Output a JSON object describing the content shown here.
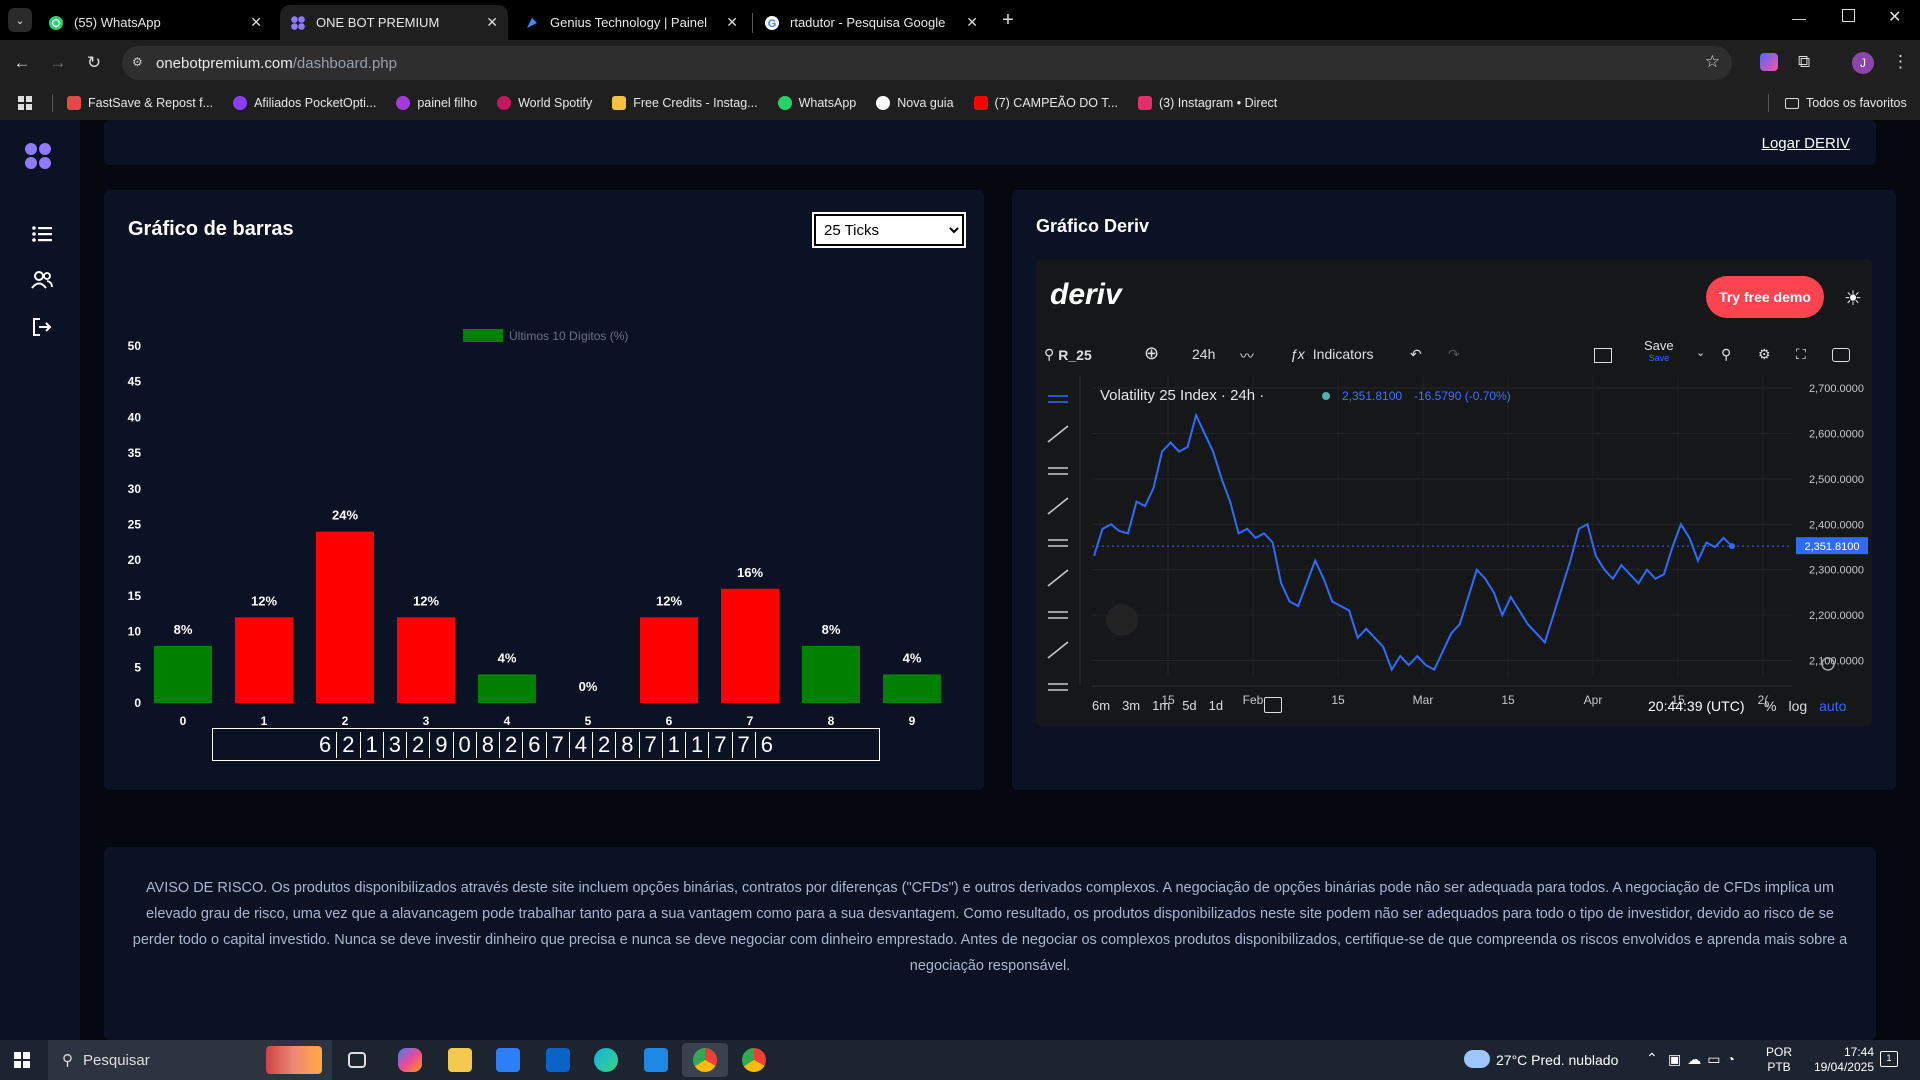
{
  "browser": {
    "tabs": [
      {
        "title": "(55) WhatsApp",
        "icon": "whatsapp-icon",
        "color": "#25d366"
      },
      {
        "title": "ONE BOT PREMIUM",
        "icon": "onebot-icon",
        "color": "#8f7bff"
      },
      {
        "title": "Genius Technology | Painel",
        "icon": "genius-icon",
        "color": "#3a8dff"
      },
      {
        "title": "rtadutor - Pesquisa Google",
        "icon": "google-icon",
        "color": "#ffffff"
      }
    ],
    "url_host": "onebotpremium.com",
    "url_path": "/dashboard.php",
    "profile_initial": "J",
    "bookmarks": [
      {
        "label": "FastSave & Repost f...",
        "color": "#e34b4b"
      },
      {
        "label": "Afiliados PocketOpti...",
        "color": "#8b3dff"
      },
      {
        "label": "painel filho",
        "color": "#a33bd6"
      },
      {
        "label": "World Spotify",
        "color": "#c2185b"
      },
      {
        "label": "Free Credits - Instag...",
        "color": "#f5c242"
      },
      {
        "label": "WhatsApp",
        "color": "#25d366"
      },
      {
        "label": "Nova guia",
        "color": "#ffffff"
      },
      {
        "label": "(7) CAMPEÃO DO T...",
        "color": "#ff0000"
      },
      {
        "label": "(3) Instagram • Direct",
        "color": "#e1306c"
      }
    ],
    "all_bookmarks": "Todos os favoritos"
  },
  "header": {
    "login_link": "Logar DERIV"
  },
  "bar_chart_panel": {
    "title": "Gráfico de barras",
    "select_value": "25 Ticks",
    "select_options": [
      "25 Ticks"
    ],
    "digits": [
      "6",
      "2",
      "1",
      "3",
      "2",
      "9",
      "0",
      "8",
      "2",
      "6",
      "7",
      "4",
      "2",
      "8",
      "7",
      "1",
      "1",
      "7",
      "7",
      "6"
    ]
  },
  "chart_data": {
    "type": "bar",
    "title": "",
    "legend": "Últimos 10 Dígitos (%)",
    "categories": [
      "0",
      "1",
      "2",
      "3",
      "4",
      "5",
      "6",
      "7",
      "8",
      "9"
    ],
    "values": [
      8,
      12,
      24,
      12,
      4,
      0,
      12,
      16,
      8,
      4
    ],
    "labels": [
      "8%",
      "12%",
      "24%",
      "12%",
      "4%",
      "0%",
      "12%",
      "16%",
      "8%",
      "4%"
    ],
    "colors": [
      "#008000",
      "#ff0000",
      "#ff0000",
      "#ff0000",
      "#008000",
      "#008000",
      "#ff0000",
      "#ff0000",
      "#008000",
      "#008000"
    ],
    "yticks": [
      "50",
      "45",
      "40",
      "35",
      "30",
      "25",
      "20",
      "15",
      "10",
      "5",
      "0"
    ],
    "ylim": [
      0,
      50
    ],
    "grid": false
  },
  "deriv_panel": {
    "title": "Gráfico Deriv",
    "logo": "deriv",
    "demo_button": "Try free demo",
    "symbol": "R_25",
    "interval": "24h",
    "indicators_label": "Indicators",
    "save_label": "Save",
    "save_sub": "Save",
    "series_title": "Volatility 25 Index · 24h ·",
    "quote": "2,351.8100",
    "change": "-16.5790 (-0.70%)",
    "price_ticks": [
      "2,700.0000",
      "2,600.0000",
      "2,500.0000",
      "2,400.0000",
      "2,300.0000",
      "2,200.0000",
      "2,100.0000"
    ],
    "price_tag": "2,351.8100",
    "x_ticks": [
      "15",
      "Feb",
      "15",
      "Mar",
      "15",
      "Apr",
      "15",
      "2("
    ],
    "periods": [
      "6m",
      "3m",
      "1m",
      "5d",
      "1d"
    ],
    "time": "20:44:39 (UTC)",
    "scale_opts": [
      "%",
      "log",
      "auto"
    ],
    "line_color": "#2f6bff",
    "chart_data": {
      "type": "line",
      "y": [
        2330,
        2390,
        2400,
        2385,
        2380,
        2450,
        2440,
        2480,
        2560,
        2580,
        2560,
        2570,
        2640,
        2600,
        2560,
        2500,
        2450,
        2380,
        2390,
        2370,
        2380,
        2360,
        2270,
        2230,
        2220,
        2270,
        2320,
        2280,
        2230,
        2220,
        2210,
        2150,
        2170,
        2150,
        2130,
        2080,
        2110,
        2090,
        2110,
        2090,
        2080,
        2120,
        2160,
        2180,
        2240,
        2300,
        2280,
        2250,
        2200,
        2240,
        2210,
        2180,
        2160,
        2140,
        2200,
        2260,
        2320,
        2390,
        2400,
        2330,
        2300,
        2280,
        2310,
        2290,
        2270,
        2300,
        2280,
        2290,
        2350,
        2400,
        2370,
        2320,
        2360,
        2350,
        2370,
        2351.81
      ]
    }
  },
  "risk": {
    "text": "AVISO DE RISCO. Os produtos disponibilizados através deste site incluem opções binárias, contratos por diferenças (\"CFDs\") e outros derivados complexos. A negociação de opções binárias pode não ser adequada para todos. A negociação de CFDs implica um elevado grau de risco, uma vez que a alavancagem pode trabalhar tanto para a sua vantagem como para a sua desvantagem. Como resultado, os produtos disponibilizados neste site podem não ser adequados para todo o tipo de investidor, devido ao risco de se perder todo o capital investido. Nunca se deve investir dinheiro que precisa e nunca se deve negociar com dinheiro emprestado. Antes de negociar os complexos produtos disponibilizados, certifique-se de que compreenda os riscos envolvidos e aprenda mais sobre a negociação responsável."
  },
  "taskbar": {
    "search_placeholder": "Pesquisar",
    "weather": "27°C  Pred. nublado",
    "lang1": "POR",
    "lang2": "PTB",
    "time": "17:44",
    "date": "19/04/2025",
    "notifications": "1"
  }
}
